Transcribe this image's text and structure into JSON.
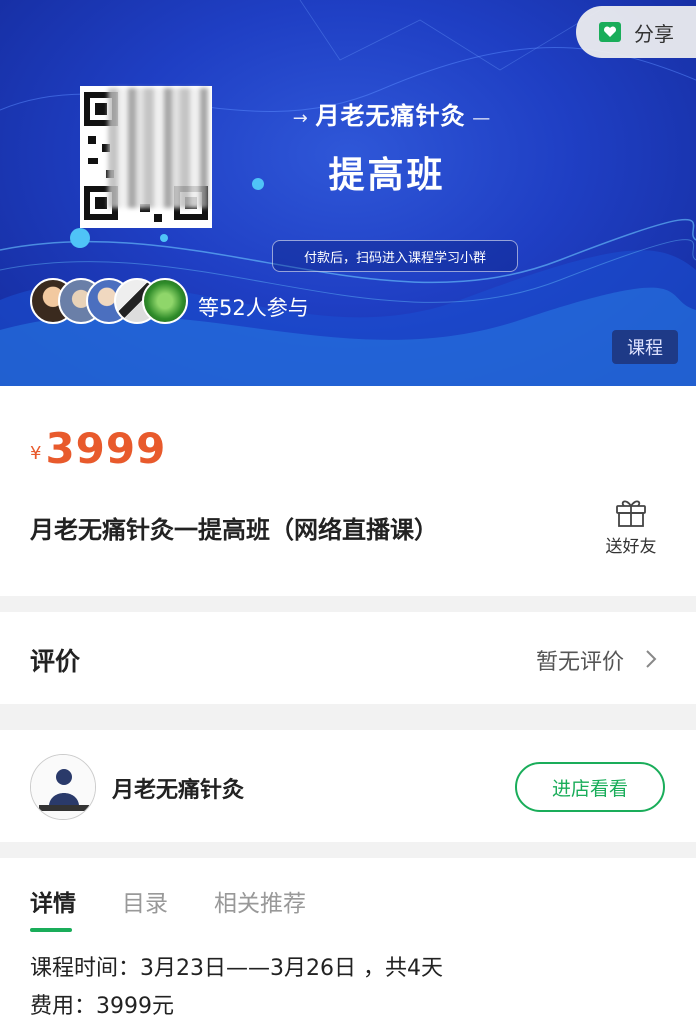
{
  "banner": {
    "share_label": "分享",
    "title_line": "月老无痛针灸",
    "title_main": "提高班",
    "note": "付款后，扫码进入课程学习小群",
    "participants": "等52人参与",
    "tag": "课程"
  },
  "product": {
    "currency": "¥",
    "price": "3999",
    "title": "月老无痛针灸一提高班（网络直播课）",
    "gift_label": "送好友"
  },
  "review": {
    "title": "评价",
    "status": "暂无评价"
  },
  "store": {
    "name": "月老无痛针灸",
    "button_label": "进店看看"
  },
  "detail": {
    "tabs": [
      {
        "label": "详情"
      },
      {
        "label": "目录"
      },
      {
        "label": "相关推荐"
      }
    ],
    "lines": [
      "课程时间：3月23日——3月26日 ，共4天",
      "费用：3999元"
    ]
  },
  "colors": {
    "price": "#e85a2c",
    "accent_green": "#1aad5a",
    "banner_blue": "#1f3fc4"
  }
}
